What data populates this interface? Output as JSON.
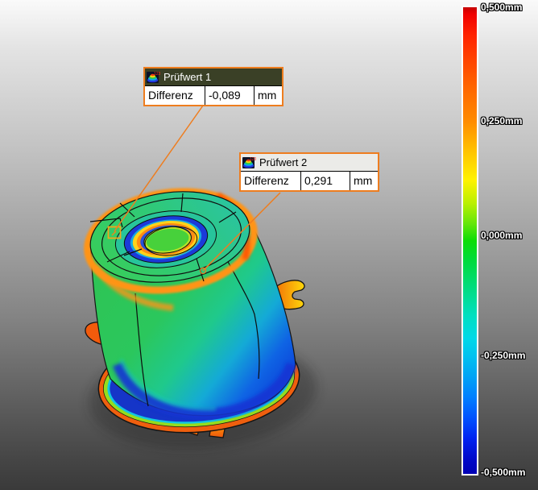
{
  "app": {
    "name": "3d-inspection-viewport"
  },
  "annotations": [
    {
      "title": "Prüfwert 1",
      "selected": true,
      "icon": "deviation-check-icon",
      "rows": [
        {
          "label": "Differenz",
          "value": "-0,089",
          "unit": "mm"
        }
      ]
    },
    {
      "title": "Prüfwert 2",
      "selected": false,
      "icon": "deviation-check-icon",
      "rows": [
        {
          "label": "Differenz",
          "value": "0,291",
          "unit": "mm"
        }
      ]
    }
  ],
  "legend": {
    "unit": "mm",
    "max_value": 0.5,
    "min_value": -0.5,
    "ticks": [
      {
        "label": "0,500mm",
        "value": 0.5
      },
      {
        "label": "0,250mm",
        "value": 0.25
      },
      {
        "label": "0,000mm",
        "value": 0.0
      },
      {
        "label": "-0,250mm",
        "value": -0.25
      },
      {
        "label": "-0,500mm",
        "value": -0.5
      }
    ]
  },
  "colors": {
    "accent_orange": "#ee7d1f",
    "selected_header_bg": "#3a4026",
    "header_bg": "#ebebe8",
    "scale_top": "#f00000",
    "scale_zero": "#0ddd06",
    "scale_bottom": "#0000b4"
  }
}
